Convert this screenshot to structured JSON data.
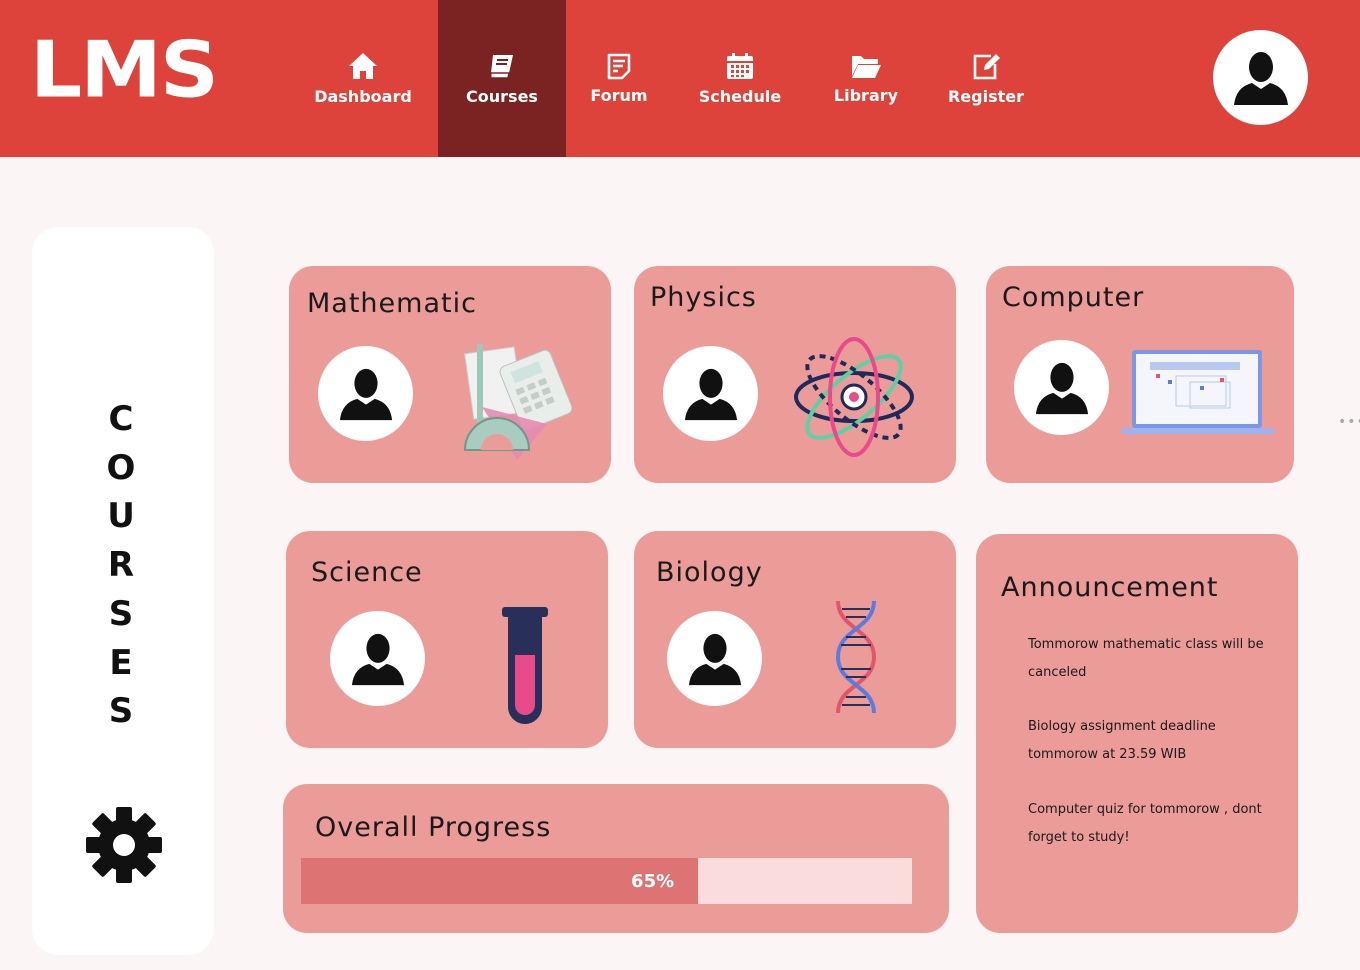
{
  "app": {
    "logo": "LMS"
  },
  "nav": {
    "items": [
      {
        "label": "Dashboard",
        "icon": "home-icon"
      },
      {
        "label": "Courses",
        "icon": "book-icon",
        "active": true
      },
      {
        "label": "Forum",
        "icon": "forum-icon"
      },
      {
        "label": "Schedule",
        "icon": "calendar-icon"
      },
      {
        "label": "Library",
        "icon": "folder-icon"
      },
      {
        "label": "Register",
        "icon": "edit-icon"
      }
    ]
  },
  "sidebar": {
    "letters": [
      "C",
      "O",
      "U",
      "R",
      "S",
      "E",
      "S"
    ],
    "icon": "gear-icon"
  },
  "courses": [
    {
      "title": "Mathematic",
      "icon": "math-tools-icon"
    },
    {
      "title": "Physics",
      "icon": "atom-icon"
    },
    {
      "title": "Computer",
      "icon": "laptop-icon"
    },
    {
      "title": "Science",
      "icon": "test-tube-icon"
    },
    {
      "title": "Biology",
      "icon": "dna-icon"
    }
  ],
  "progress": {
    "title": "Overall Progress",
    "percent": 65,
    "label": "65%"
  },
  "announcement": {
    "title": "Announcement",
    "items": [
      "Tommorow mathematic class will be canceled",
      "Biology assignment deadline tommorow at 23.59 WIB",
      "Computer quiz for tommorow , dont forget to study!"
    ]
  },
  "colors": {
    "header": "#dd433b",
    "active_nav": "#7b2322",
    "card": "#ec9c98",
    "background": "#fcf5f5"
  }
}
